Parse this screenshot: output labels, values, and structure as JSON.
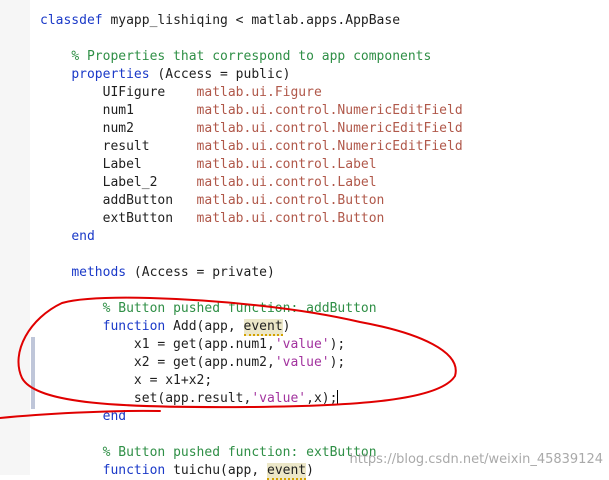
{
  "editor": {
    "lines": [
      {
        "parts": [
          {
            "t": "kw",
            "s": "classdef"
          },
          {
            "t": "tx",
            "s": " myapp_lishiqing < matlab.apps.AppBase"
          }
        ]
      },
      {
        "parts": []
      },
      {
        "parts": [
          {
            "t": "tx",
            "s": "    "
          },
          {
            "t": "cm",
            "s": "% Properties that correspond to app components"
          }
        ]
      },
      {
        "parts": [
          {
            "t": "tx",
            "s": "    "
          },
          {
            "t": "kw",
            "s": "properties"
          },
          {
            "t": "tx",
            "s": " (Access = public)"
          }
        ]
      },
      {
        "parts": [
          {
            "t": "tx",
            "s": "        UIFigure    "
          },
          {
            "t": "ty",
            "s": "matlab.ui.Figure"
          }
        ]
      },
      {
        "parts": [
          {
            "t": "tx",
            "s": "        num1        "
          },
          {
            "t": "ty",
            "s": "matlab.ui.control.NumericEditField"
          }
        ]
      },
      {
        "parts": [
          {
            "t": "tx",
            "s": "        num2        "
          },
          {
            "t": "ty",
            "s": "matlab.ui.control.NumericEditField"
          }
        ]
      },
      {
        "parts": [
          {
            "t": "tx",
            "s": "        result      "
          },
          {
            "t": "ty",
            "s": "matlab.ui.control.NumericEditField"
          }
        ]
      },
      {
        "parts": [
          {
            "t": "tx",
            "s": "        Label       "
          },
          {
            "t": "ty",
            "s": "matlab.ui.control.Label"
          }
        ]
      },
      {
        "parts": [
          {
            "t": "tx",
            "s": "        Label_2     "
          },
          {
            "t": "ty",
            "s": "matlab.ui.control.Label"
          }
        ]
      },
      {
        "parts": [
          {
            "t": "tx",
            "s": "        addButton   "
          },
          {
            "t": "ty",
            "s": "matlab.ui.control.Button"
          }
        ]
      },
      {
        "parts": [
          {
            "t": "tx",
            "s": "        extButton   "
          },
          {
            "t": "ty",
            "s": "matlab.ui.control.Button"
          }
        ]
      },
      {
        "parts": [
          {
            "t": "tx",
            "s": "    "
          },
          {
            "t": "kw",
            "s": "end"
          }
        ]
      },
      {
        "parts": []
      },
      {
        "parts": [
          {
            "t": "tx",
            "s": "    "
          },
          {
            "t": "kw",
            "s": "methods"
          },
          {
            "t": "tx",
            "s": " (Access = private)"
          }
        ]
      },
      {
        "parts": []
      },
      {
        "parts": [
          {
            "t": "tx",
            "s": "        "
          },
          {
            "t": "cm",
            "s": "% Button pushed function: addButton"
          }
        ]
      },
      {
        "parts": [
          {
            "t": "tx",
            "s": "        "
          },
          {
            "t": "kw",
            "s": "function"
          },
          {
            "t": "tx",
            "s": " Add(app, "
          },
          {
            "t": "hl",
            "s": "event"
          },
          {
            "t": "tx",
            "s": ")"
          }
        ]
      },
      {
        "parts": [
          {
            "t": "tx",
            "s": "            x1 = get(app.num1,"
          },
          {
            "t": "st",
            "s": "'value'"
          },
          {
            "t": "tx",
            "s": ");"
          }
        ]
      },
      {
        "parts": [
          {
            "t": "tx",
            "s": "            x2 = get(app.num2,"
          },
          {
            "t": "st",
            "s": "'value'"
          },
          {
            "t": "tx",
            "s": ");"
          }
        ]
      },
      {
        "parts": [
          {
            "t": "tx",
            "s": "            x = x1+x2;"
          }
        ]
      },
      {
        "parts": [
          {
            "t": "tx",
            "s": "            set(app.result,"
          },
          {
            "t": "st",
            "s": "'value'"
          },
          {
            "t": "tx",
            "s": ",x);"
          },
          {
            "t": "cursor",
            "s": ""
          }
        ]
      },
      {
        "parts": [
          {
            "t": "tx",
            "s": "        "
          },
          {
            "t": "kw",
            "s": "end"
          }
        ]
      },
      {
        "parts": []
      },
      {
        "parts": [
          {
            "t": "tx",
            "s": "        "
          },
          {
            "t": "cm",
            "s": "% Button pushed function: extButton"
          }
        ]
      },
      {
        "parts": [
          {
            "t": "tx",
            "s": "        "
          },
          {
            "t": "kw",
            "s": "function"
          },
          {
            "t": "tx",
            "s": " tuichu(app, "
          },
          {
            "t": "hl",
            "s": "event"
          },
          {
            "t": "tx",
            "s": ")"
          }
        ]
      }
    ]
  },
  "colors": {
    "keyword": "#1a39c8",
    "comment": "#2f8f46",
    "type": "#b0584a",
    "string": "#a2329e",
    "annotation": "#e00000"
  },
  "watermark": "https://blog.csdn.net/weixin_45839124"
}
